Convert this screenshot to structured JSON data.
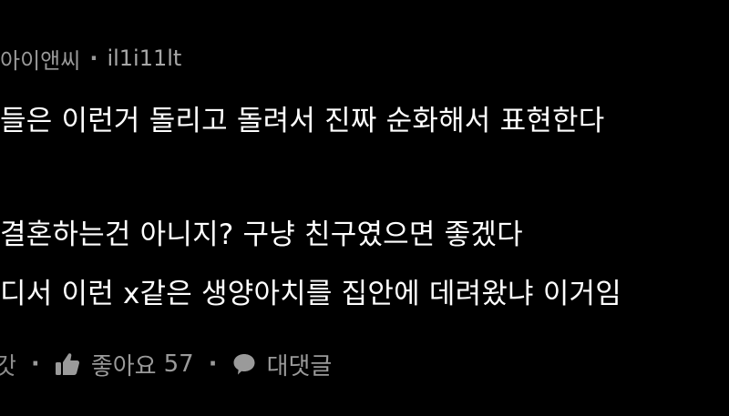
{
  "comment": {
    "author": "아이앤씨",
    "separator": "·",
    "handle": "il1i11lt",
    "lines": [
      "들은 이런거 돌리고 돌려서 진짜 순화해서 표현한다",
      "결혼하는건 아니지? 구냥 친구였으면 좋겠다",
      "디서 이런 x같은 생양아치를 집안에 데려왔냐  이거임"
    ]
  },
  "footer": {
    "edge_glyph": "갓",
    "separator": "·",
    "like_label": "좋아요",
    "like_count": "57",
    "reply_label": "대댓글"
  },
  "icons": {
    "like": "thumbs-up-icon",
    "reply": "speech-bubble-icon"
  },
  "colors": {
    "background": "#000000",
    "primary_text": "#ffffff",
    "secondary_text": "#9a9a9a"
  }
}
